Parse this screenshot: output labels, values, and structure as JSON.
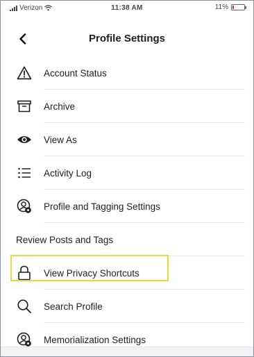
{
  "status_bar": {
    "carrier": "Verizon",
    "time": "11:38 AM",
    "battery": "11%",
    "battery_level": 0.11,
    "battery_color": "#e0245e"
  },
  "header": {
    "title": "Profile Settings",
    "back_icon": "chevron-left-icon"
  },
  "menu": {
    "items": [
      {
        "label": "Account Status",
        "icon": "warning-triangle-icon"
      },
      {
        "label": "Archive",
        "icon": "archive-box-icon"
      },
      {
        "label": "View As",
        "icon": "eye-icon"
      },
      {
        "label": "Activity Log",
        "icon": "list-icon"
      },
      {
        "label": "Profile and Tagging Settings",
        "icon": "user-gear-icon"
      },
      {
        "label": "Review Posts and Tags",
        "icon": ""
      },
      {
        "label": "View Privacy Shortcuts",
        "icon": "lock-icon",
        "highlighted": true
      },
      {
        "label": "Search Profile",
        "icon": "search-icon"
      },
      {
        "label": "Memorialization Settings",
        "icon": "user-gear-icon"
      }
    ]
  },
  "colors": {
    "highlight": "#ead53a",
    "text": "#1c1e21",
    "divider": "#e7e9ec"
  }
}
